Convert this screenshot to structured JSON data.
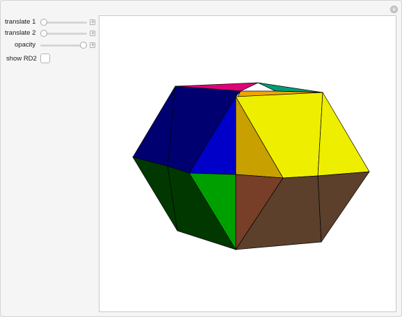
{
  "controls": {
    "translate1": {
      "label": "translate 1",
      "value": 0.0
    },
    "translate2": {
      "label": "translate 2",
      "value": 0.0
    },
    "opacity": {
      "label": "opacity",
      "value": 1.0
    },
    "show_rd2": {
      "label": "show RD2",
      "checked": false
    }
  },
  "corner_button": {
    "glyph": "+"
  },
  "plus_glyph": "+",
  "faces": {
    "top_magenta": "#e0007a",
    "top_teal": "#009e73",
    "top_orange": "#f0a500",
    "navy": "#000070",
    "blue": "#0000c8",
    "yellow": "#eeee00",
    "gold": "#c8a000",
    "dark_green": "#003800",
    "green": "#009f00",
    "rust": "#783f28",
    "brown": "#5c402c"
  }
}
